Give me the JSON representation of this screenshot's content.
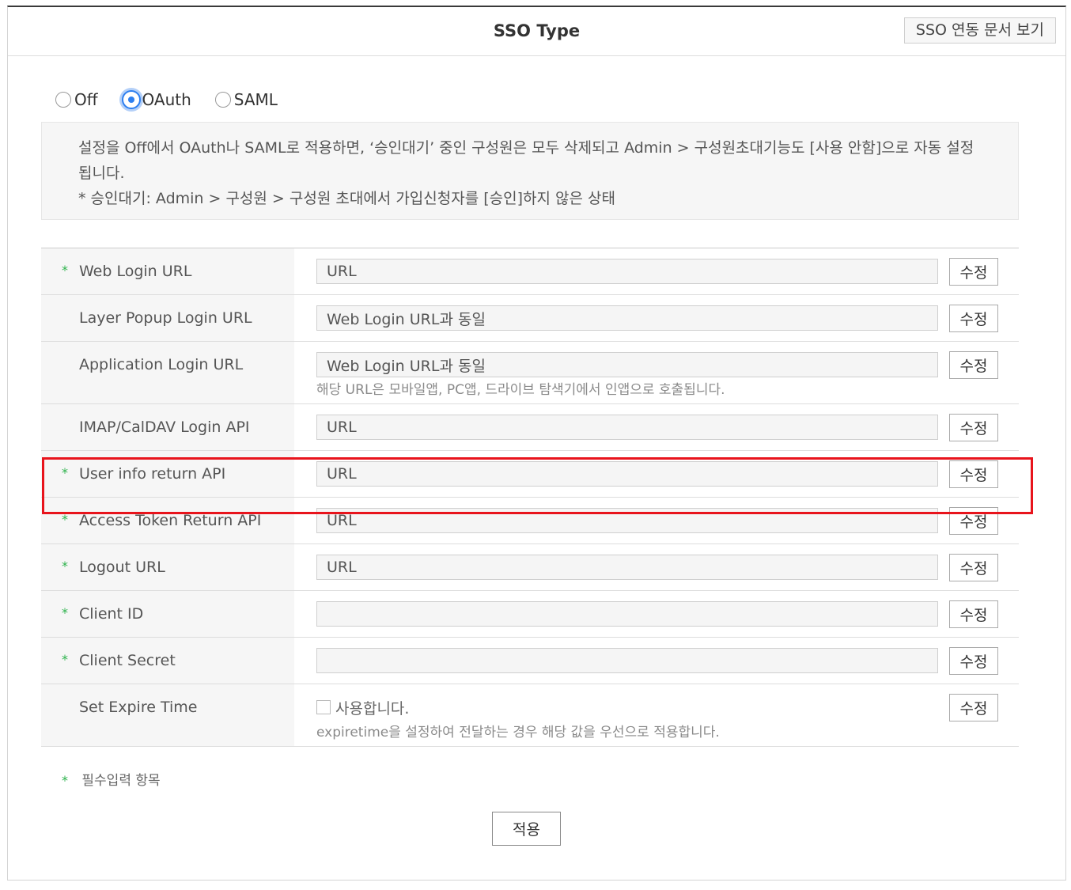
{
  "header": {
    "title": "SSO Type",
    "doc_button": "SSO 연동 문서 보기"
  },
  "sso_type": {
    "options": [
      {
        "label": "Off",
        "checked": false
      },
      {
        "label": "OAuth",
        "checked": true
      },
      {
        "label": "SAML",
        "checked": false
      }
    ]
  },
  "notice": {
    "line1": "설정을 Off에서 OAuth나 SAML로 적용하면, ‘승인대기’ 중인 구성원은 모두 삭제되고 Admin > 구성원초대기능도 [사용 안함]으로 자동 설정됩니다.",
    "line2": "* 승인대기: Admin > 구성원 > 구성원 초대에서 가입신청자를 [승인]하지 않은 상태"
  },
  "form": {
    "required_mark": "*",
    "edit_label": "수정",
    "rows": [
      {
        "label": "Web Login URL",
        "required": true,
        "value": "URL"
      },
      {
        "label": "Layer Popup Login URL",
        "required": false,
        "value": "Web Login URL과 동일"
      },
      {
        "label": "Application Login URL",
        "required": false,
        "value": "Web Login URL과 동일",
        "help": "해당 URL은 모바일앱, PC앱, 드라이브 탐색기에서 인앱으로 호출됩니다."
      },
      {
        "label": "IMAP/CalDAV Login API",
        "required": false,
        "value": "URL"
      },
      {
        "label": "User info return API",
        "required": true,
        "value": "URL"
      },
      {
        "label": "Access Token Return API",
        "required": true,
        "value": "URL"
      },
      {
        "label": "Logout URL",
        "required": true,
        "value": "URL"
      },
      {
        "label": "Client ID",
        "required": true,
        "value": ""
      },
      {
        "label": "Client Secret",
        "required": true,
        "value": ""
      },
      {
        "label": "Set Expire Time",
        "required": false,
        "checkbox_label": "사용합니다.",
        "checked": false,
        "help": "expiretime을 설정하여 전달하는 경우 해당 값을 우선으로 적용합니다."
      }
    ]
  },
  "footer": {
    "required_note": "필수입력 항목",
    "apply_button": "적용"
  },
  "colors": {
    "accent": "#2d7ff0",
    "required_star": "#2eb34d",
    "highlight": "#e8141c"
  }
}
